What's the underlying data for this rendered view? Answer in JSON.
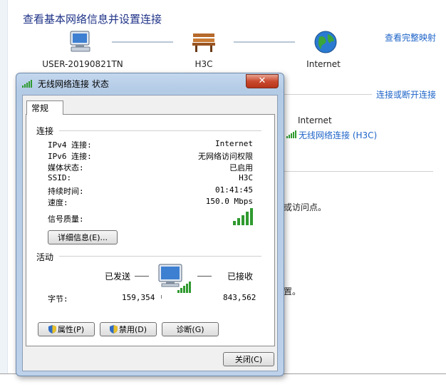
{
  "page": {
    "title": "查看基本网络信息并设置连接",
    "map_link": "查看完整映射",
    "connect_link": "连接或断开连接",
    "nodes": [
      {
        "label": "USER-20190821TN",
        "icon": "computer-icon"
      },
      {
        "label": "H3C",
        "icon": "bench-icon"
      },
      {
        "label": "Internet",
        "icon": "globe-icon"
      }
    ],
    "network_access_value": "Internet",
    "connection_link": "无线网络连接 (H3C)",
    "partial_text_1": "或访问点。",
    "partial_text_2": "置。"
  },
  "dialog": {
    "title": "无线网络连接 状态",
    "close_label": "✕",
    "tab": "常规",
    "connection": {
      "group": "连接",
      "rows": [
        {
          "label": "IPv4 连接:",
          "value": "Internet"
        },
        {
          "label": "IPv6 连接:",
          "value": "无网络访问权限"
        },
        {
          "label": "媒体状态:",
          "value": "已启用"
        },
        {
          "label": "SSID:",
          "value": "H3C"
        },
        {
          "label": "持续时间:",
          "value": "01:41:45"
        },
        {
          "label": "速度:",
          "value": "150.0 Mbps"
        }
      ],
      "signal_label": "信号质量:",
      "signal_bars": 5,
      "details_button": "详细信息(E)..."
    },
    "activity": {
      "group": "活动",
      "sent_label": "已发送",
      "received_label": "已接收",
      "bytes_label": "字节:",
      "sent_bytes": "159,354",
      "received_bytes": "843,562"
    },
    "buttons": {
      "properties": "属性(P)",
      "disable": "禁用(D)",
      "diagnose": "诊断(G)",
      "close": "关闭(C)"
    }
  }
}
